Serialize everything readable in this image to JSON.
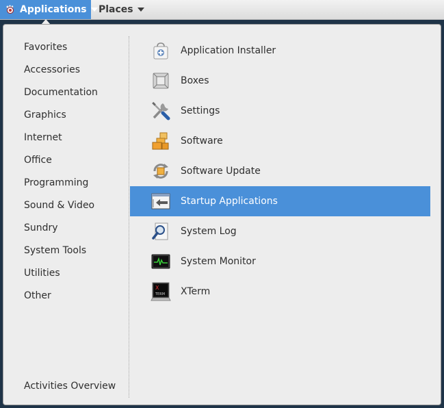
{
  "topbar": {
    "applications_label": "Applications",
    "places_label": "Places"
  },
  "categories": [
    "Favorites",
    "Accessories",
    "Documentation",
    "Graphics",
    "Internet",
    "Office",
    "Programming",
    "Sound & Video",
    "Sundry",
    "System Tools",
    "Utilities",
    "Other"
  ],
  "activities_label": "Activities Overview",
  "apps": [
    {
      "label": "Application Installer",
      "icon": "application-installer-icon"
    },
    {
      "label": "Boxes",
      "icon": "boxes-icon"
    },
    {
      "label": "Settings",
      "icon": "settings-icon"
    },
    {
      "label": "Software",
      "icon": "software-icon"
    },
    {
      "label": "Software Update",
      "icon": "software-update-icon"
    },
    {
      "label": "Startup Applications",
      "icon": "startup-applications-icon",
      "selected": true
    },
    {
      "label": "System Log",
      "icon": "system-log-icon"
    },
    {
      "label": "System Monitor",
      "icon": "system-monitor-icon"
    },
    {
      "label": "XTerm",
      "icon": "xterm-icon"
    }
  ],
  "icon_text": {
    "xterm_top": "X",
    "xterm_bottom": "TERM"
  },
  "colors": {
    "accent": "#4a90d9",
    "panel": "#ededed",
    "topbar": "#e6e6e6"
  }
}
